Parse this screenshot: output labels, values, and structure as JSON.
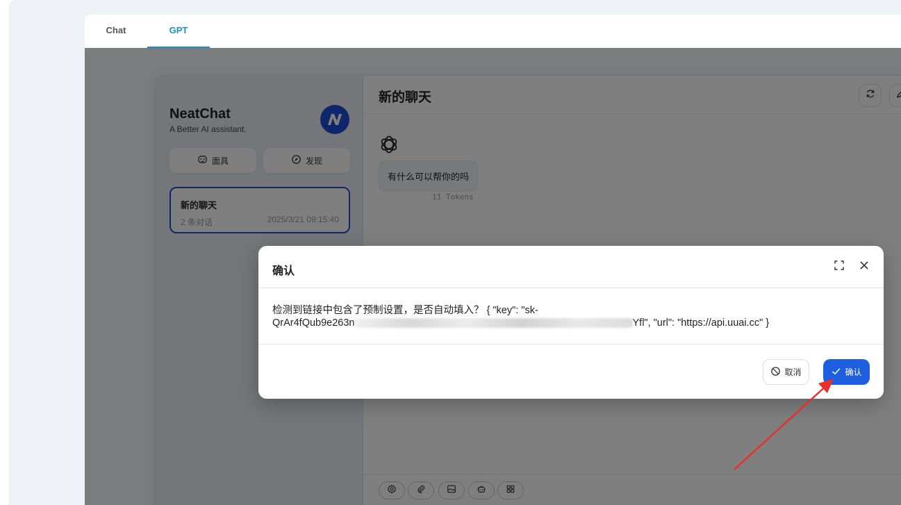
{
  "tabs": [
    {
      "label": "Chat",
      "active": false
    },
    {
      "label": "GPT",
      "active": true
    }
  ],
  "sidebar": {
    "brand_title": "NeatChat",
    "brand_subtitle": "A Better AI assistant.",
    "mask_button": "面具",
    "discover_button": "发现",
    "chat_item": {
      "title": "新的聊天",
      "count": "2 条对话",
      "time": "2025/3/21 09:15:40"
    }
  },
  "main": {
    "title": "新的聊天",
    "bot_message": "有什么可以帮你的吗",
    "tokens": "11 Tokens"
  },
  "modal": {
    "title": "确认",
    "body_line1": "检测到链接中包含了预制设置，是否自动填入？ { \"key\": \"sk-",
    "body_line2_start": "QrAr4fQub9e263n",
    "body_line2_end": "Yfl\", \"url\": \"https://api.uuai.cc\" }",
    "cancel_label": "取消",
    "confirm_label": "确认"
  },
  "colors": {
    "accent": "#1d5fe0",
    "tab_active": "#1e90c8",
    "annotation_arrow": "#e8302a"
  }
}
